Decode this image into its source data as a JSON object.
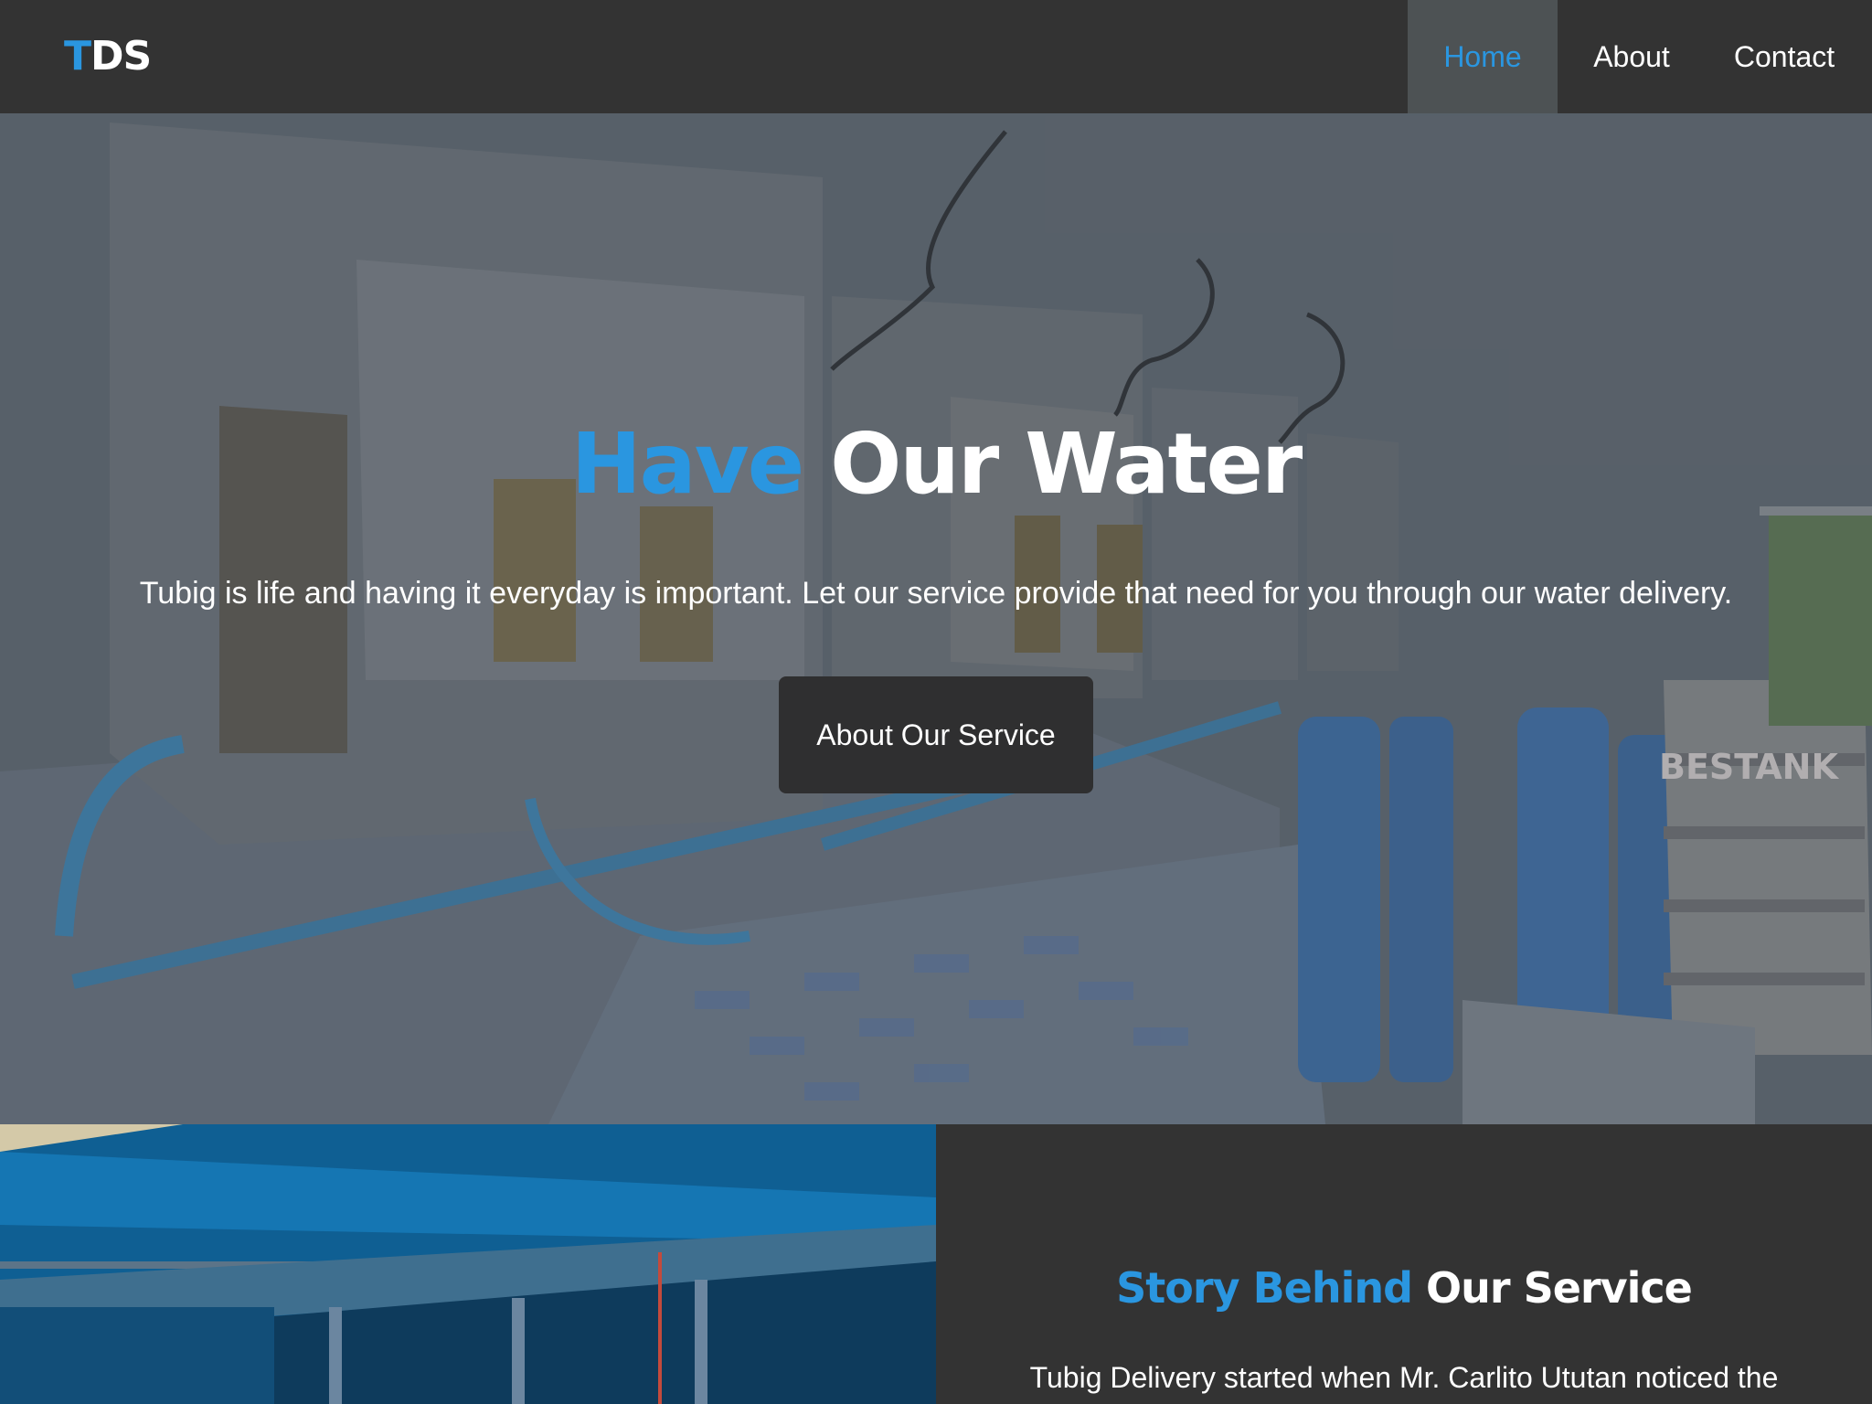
{
  "header": {
    "logo_first_letter": "T",
    "logo_rest": "DS",
    "nav": [
      {
        "label": "Home",
        "active": true
      },
      {
        "label": "About",
        "active": false
      },
      {
        "label": "Contact",
        "active": false
      }
    ]
  },
  "hero": {
    "title_accent": "Have",
    "title_rest": "Our Water",
    "tagline": "Tubig is life and having it everyday is important. Let our service provide that need for you through our water delivery.",
    "button_label": "About Our Service",
    "tank_label": "BESTANK"
  },
  "story": {
    "title_accent": "Story Behind",
    "title_rest": "Our Service",
    "text": "Tubig Delivery started when Mr. Carlito Ututan noticed the"
  },
  "colors": {
    "accent": "#2a96e0",
    "header_bg": "#333333",
    "active_nav_bg": "#4d5254",
    "button_bg": "#2f2f30"
  }
}
